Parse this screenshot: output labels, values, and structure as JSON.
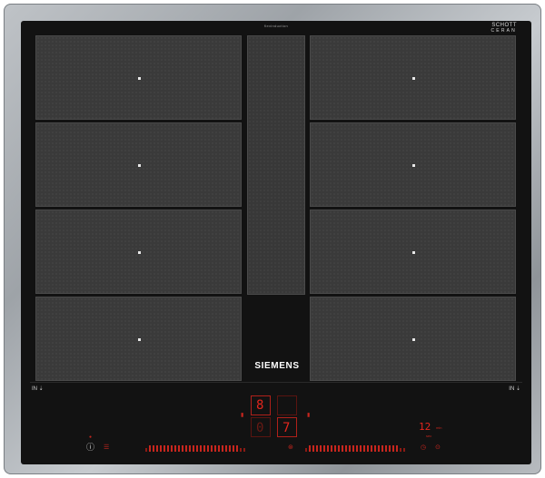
{
  "brand": {
    "name": "SIEMENS"
  },
  "glass_brand": {
    "line1": "SCHOTT",
    "line2": "CERAN"
  },
  "top_label": "flexinduction",
  "zones": [
    {
      "id": "left-1"
    },
    {
      "id": "left-2"
    },
    {
      "id": "left-3"
    },
    {
      "id": "left-4"
    },
    {
      "id": "right-1"
    },
    {
      "id": "right-2"
    },
    {
      "id": "right-3"
    },
    {
      "id": "right-4"
    }
  ],
  "flex_labels": {
    "left": "IN",
    "right": "IN"
  },
  "controls": {
    "zone_display_top": "8",
    "zone_display_bottom": "7",
    "timer_value": "12",
    "timer_unit": "min",
    "timer_sub": "sec"
  },
  "colors": {
    "glass": "#121212",
    "zone": "#3a3a3a",
    "display_red": "#e3261d",
    "steel": "#a8adb2"
  },
  "icons": {
    "power": "power-icon",
    "menu": "menu-icon",
    "left_slider": "power-level-slider",
    "right_slider": "power-level-slider",
    "center": "boost-icon",
    "timer": "timer-icon",
    "clock": "clock-icon"
  }
}
